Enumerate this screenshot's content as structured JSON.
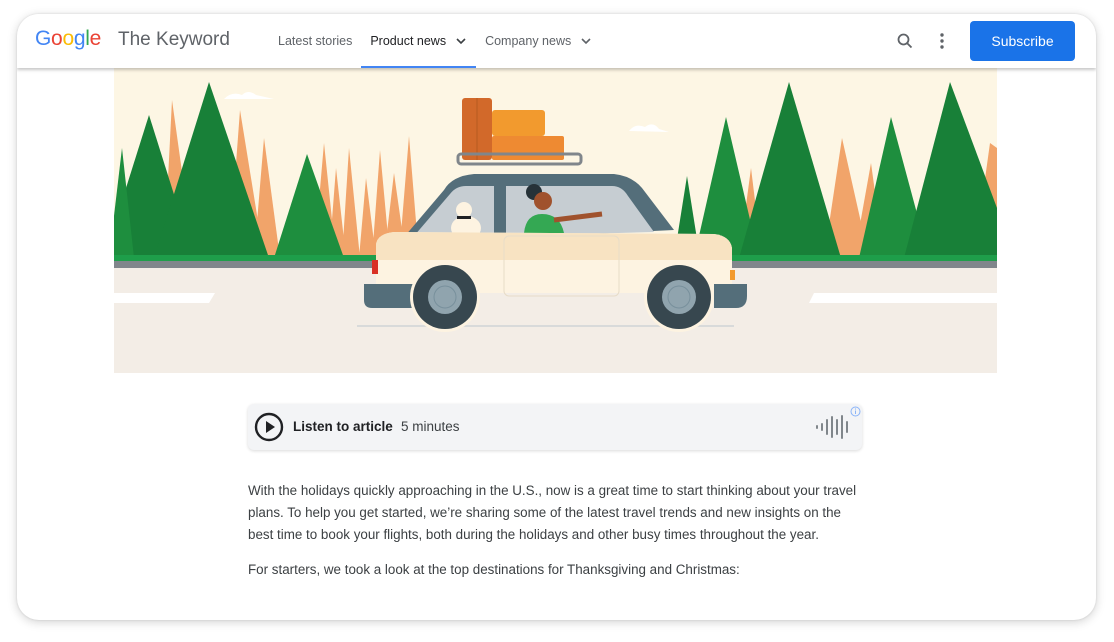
{
  "header": {
    "logo": {
      "letters": [
        "G",
        "o",
        "o",
        "g",
        "l",
        "e"
      ],
      "colors": [
        "#4285f4",
        "#ea4335",
        "#fbbc05",
        "#4285f4",
        "#34a853",
        "#ea4335"
      ]
    },
    "brand": "The Keyword",
    "nav": [
      {
        "label": "Latest stories",
        "dropdown": false,
        "active": false
      },
      {
        "label": "Product news",
        "dropdown": true,
        "active": true
      },
      {
        "label": "Company news",
        "dropdown": true,
        "active": false
      }
    ],
    "search_icon": "search-icon",
    "more_icon": "more-vert-icon",
    "subscribe_label": "Subscribe",
    "accent": "#1a73e8"
  },
  "hero": {
    "description": "Illustration of a car with luggage on roof rack, a dog and a woman driving past pine trees",
    "colors": {
      "sky": "#fdf6e4",
      "tree_dark": "#188038",
      "tree_light": "#1e8e3e",
      "tree_orange": "#f1a46a",
      "road": "#f3ede6",
      "car_body": "#fdf3e1",
      "car_trim": "#546e7a"
    }
  },
  "listen": {
    "label": "Listen to article",
    "duration": "5 minutes",
    "play_icon": "play-icon",
    "wave_icon": "audio-wave-icon",
    "info_icon": "info-icon"
  },
  "article": {
    "paragraphs": [
      "With the holidays quickly approaching in the U.S., now is a great time to start thinking about your travel plans. To help you get started, we’re sharing some of the latest travel trends and new insights on the best time to book your flights, both during the holidays and other busy times throughout the year.",
      "For starters, we took a look at the top destinations for Thanksgiving and Christmas:"
    ]
  }
}
